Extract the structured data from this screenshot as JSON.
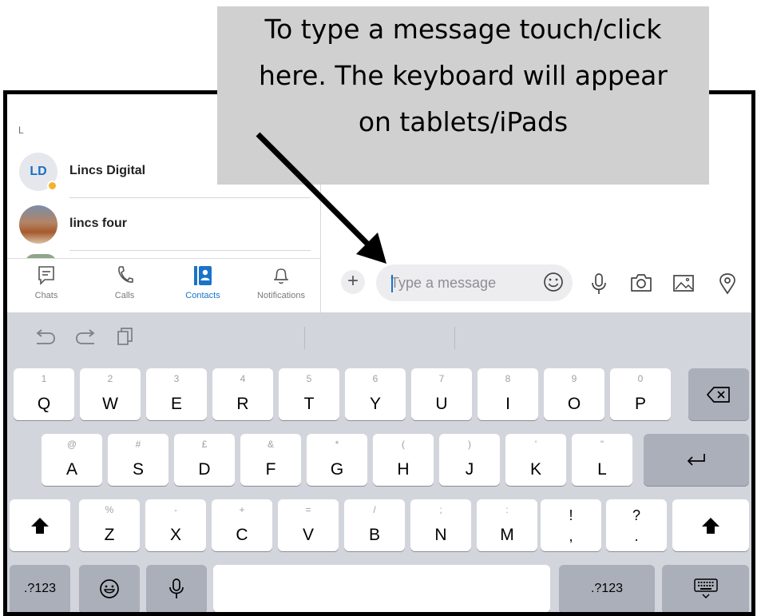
{
  "annotation": {
    "lines": [
      "To type a message touch/click",
      "here. The keyboard will appear",
      "on tablets/iPads"
    ]
  },
  "contacts": {
    "section_letter": "L",
    "items": [
      {
        "initials": "LD",
        "name": "Lincs Digital",
        "status": "away"
      },
      {
        "initials": "",
        "name": "lincs four"
      }
    ]
  },
  "tabs": [
    {
      "label": "Chats",
      "icon": "chat-icon",
      "active": false
    },
    {
      "label": "Calls",
      "icon": "phone-icon",
      "active": false
    },
    {
      "label": "Contacts",
      "icon": "contacts-icon",
      "active": true
    },
    {
      "label": "Notifications",
      "icon": "bell-icon",
      "active": false
    }
  ],
  "compose": {
    "placeholder": "Type a message",
    "plus": "+",
    "icons": [
      "plus-icon",
      "emoji-icon",
      "microphone-icon",
      "camera-icon",
      "image-icon",
      "location-icon"
    ]
  },
  "keyboard": {
    "row1": [
      {
        "hint": "1",
        "key": "Q"
      },
      {
        "hint": "2",
        "key": "W"
      },
      {
        "hint": "3",
        "key": "E"
      },
      {
        "hint": "4",
        "key": "R"
      },
      {
        "hint": "5",
        "key": "T"
      },
      {
        "hint": "6",
        "key": "Y"
      },
      {
        "hint": "7",
        "key": "U"
      },
      {
        "hint": "8",
        "key": "I"
      },
      {
        "hint": "9",
        "key": "O"
      },
      {
        "hint": "0",
        "key": "P"
      }
    ],
    "row2": [
      {
        "hint": "@",
        "key": "A"
      },
      {
        "hint": "#",
        "key": "S"
      },
      {
        "hint": "£",
        "key": "D"
      },
      {
        "hint": "&",
        "key": "F"
      },
      {
        "hint": "*",
        "key": "G"
      },
      {
        "hint": "(",
        "key": "H"
      },
      {
        "hint": ")",
        "key": "J"
      },
      {
        "hint": "'",
        "key": "K"
      },
      {
        "hint": "\"",
        "key": "L"
      }
    ],
    "row3": [
      {
        "hint": "%",
        "key": "Z"
      },
      {
        "hint": "-",
        "key": "X"
      },
      {
        "hint": "+",
        "key": "C"
      },
      {
        "hint": "=",
        "key": "V"
      },
      {
        "hint": "/",
        "key": "B"
      },
      {
        "hint": ";",
        "key": "N"
      },
      {
        "hint": ":",
        "key": "M"
      }
    ],
    "punct": [
      {
        "top": "!",
        "bottom": ","
      },
      {
        "top": "?",
        "bottom": "."
      }
    ],
    "numbers_label": ".?123"
  }
}
